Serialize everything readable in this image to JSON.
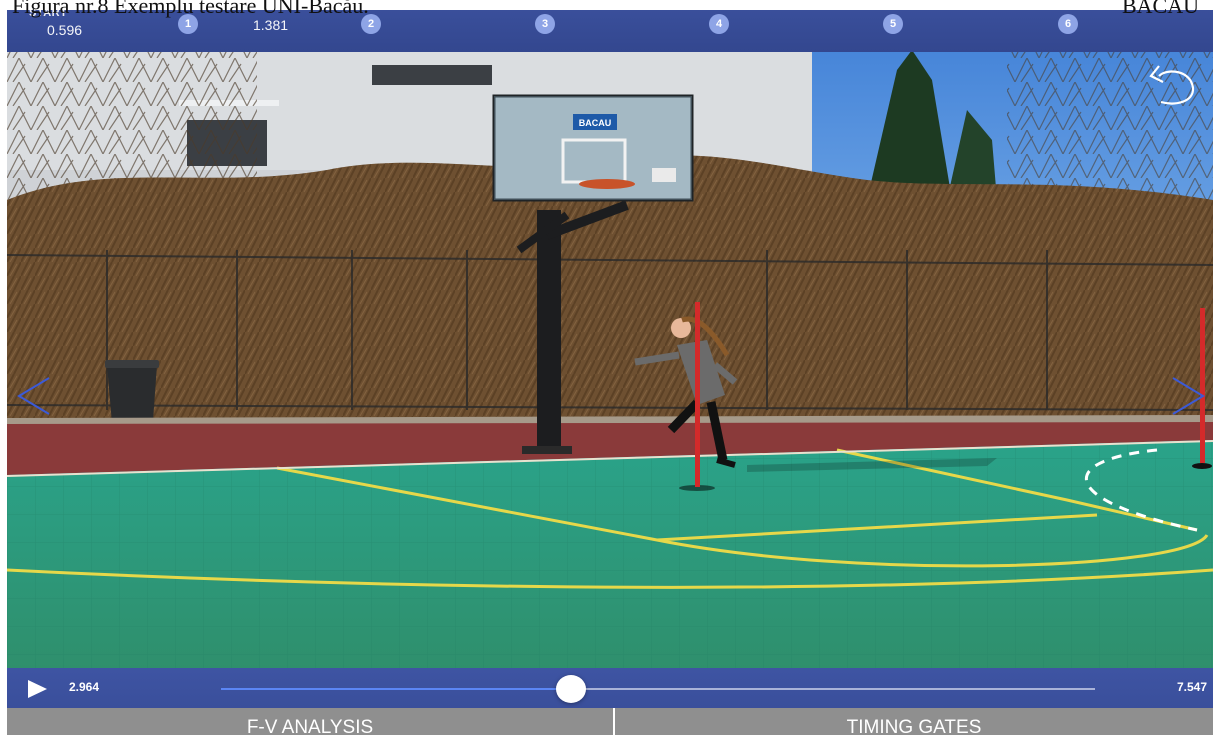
{
  "document": {
    "caption": "Figura nr.8 Exemplu testare UNI-Bacău.",
    "caption_right": "BACAU"
  },
  "laps_bar": {
    "start_label": "START",
    "start_time": "0.596",
    "split_time": "1.381",
    "markers": [
      "1",
      "2",
      "3",
      "4",
      "5",
      "6"
    ]
  },
  "video_overlay": {
    "backboard_sign": "BACAU",
    "back_icon": "undo-arrow-icon",
    "prev_icon": "chevron-left-icon",
    "next_icon": "chevron-right-icon"
  },
  "playback": {
    "current_time": "2.964",
    "total_time": "7.547",
    "progress": 0.4,
    "play_icon": "play-icon"
  },
  "tabs": [
    {
      "label": "F-V ANALYSIS"
    },
    {
      "label": "TIMING GATES"
    }
  ],
  "colors": {
    "bar_blue": "#33478f",
    "marker": "#8ea4e6",
    "scrub_fill": "#5b86f5",
    "tab_gray": "#8f8f8f",
    "court_green": "#2f9d7c",
    "court_line": "#e6d84a",
    "pole_red": "#d42a2a"
  }
}
